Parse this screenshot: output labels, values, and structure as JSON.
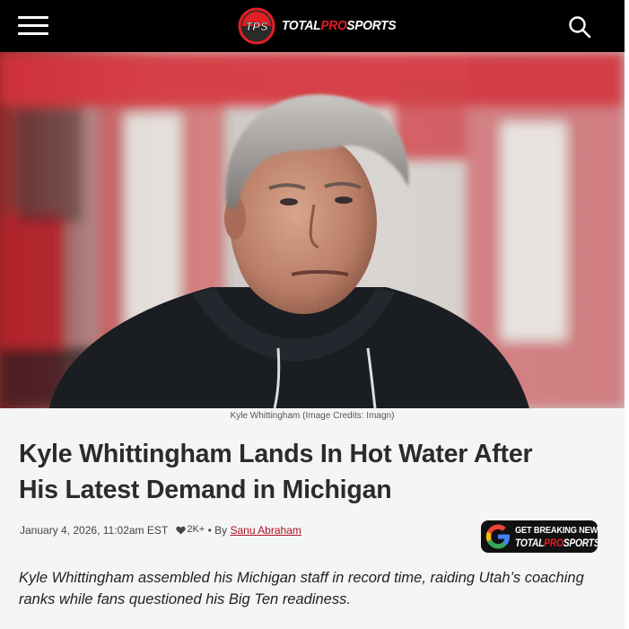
{
  "header": {
    "logo_badge": "TPS",
    "logo_text_prefix": "TOTAL",
    "logo_text_accent": "PRO",
    "logo_text_suffix": "SPORTS",
    "menu_icon": "hamburger-menu-icon",
    "search_icon": "search-icon"
  },
  "hero": {
    "caption": "Kyle Whittingham (Image Credits: Imagn)"
  },
  "article": {
    "title_line1": "Kyle Whittingham Lands In Hot Water After",
    "title_line2": "His Latest Demand in Michigan",
    "date": "January 4, 2026, 11:02am EST",
    "likes": "2K+",
    "by": "• By",
    "author": "Sanu Abraham",
    "excerpt": "Kyle Whittingham assembled his Michigan staff in record time, raiding Utah’s coaching ranks while fans questioned his Big Ten readiness."
  },
  "google_news": {
    "line1": "GET BREAKING NEWS",
    "line2_prefix": "TOTAL",
    "line2_accent": "PRO",
    "line2_suffix": "SPORTS"
  },
  "colors": {
    "header_bg": "#000000",
    "brand_red": "#e31e24",
    "author_link": "#b1101e",
    "page_bg": "#f4f5f7"
  }
}
